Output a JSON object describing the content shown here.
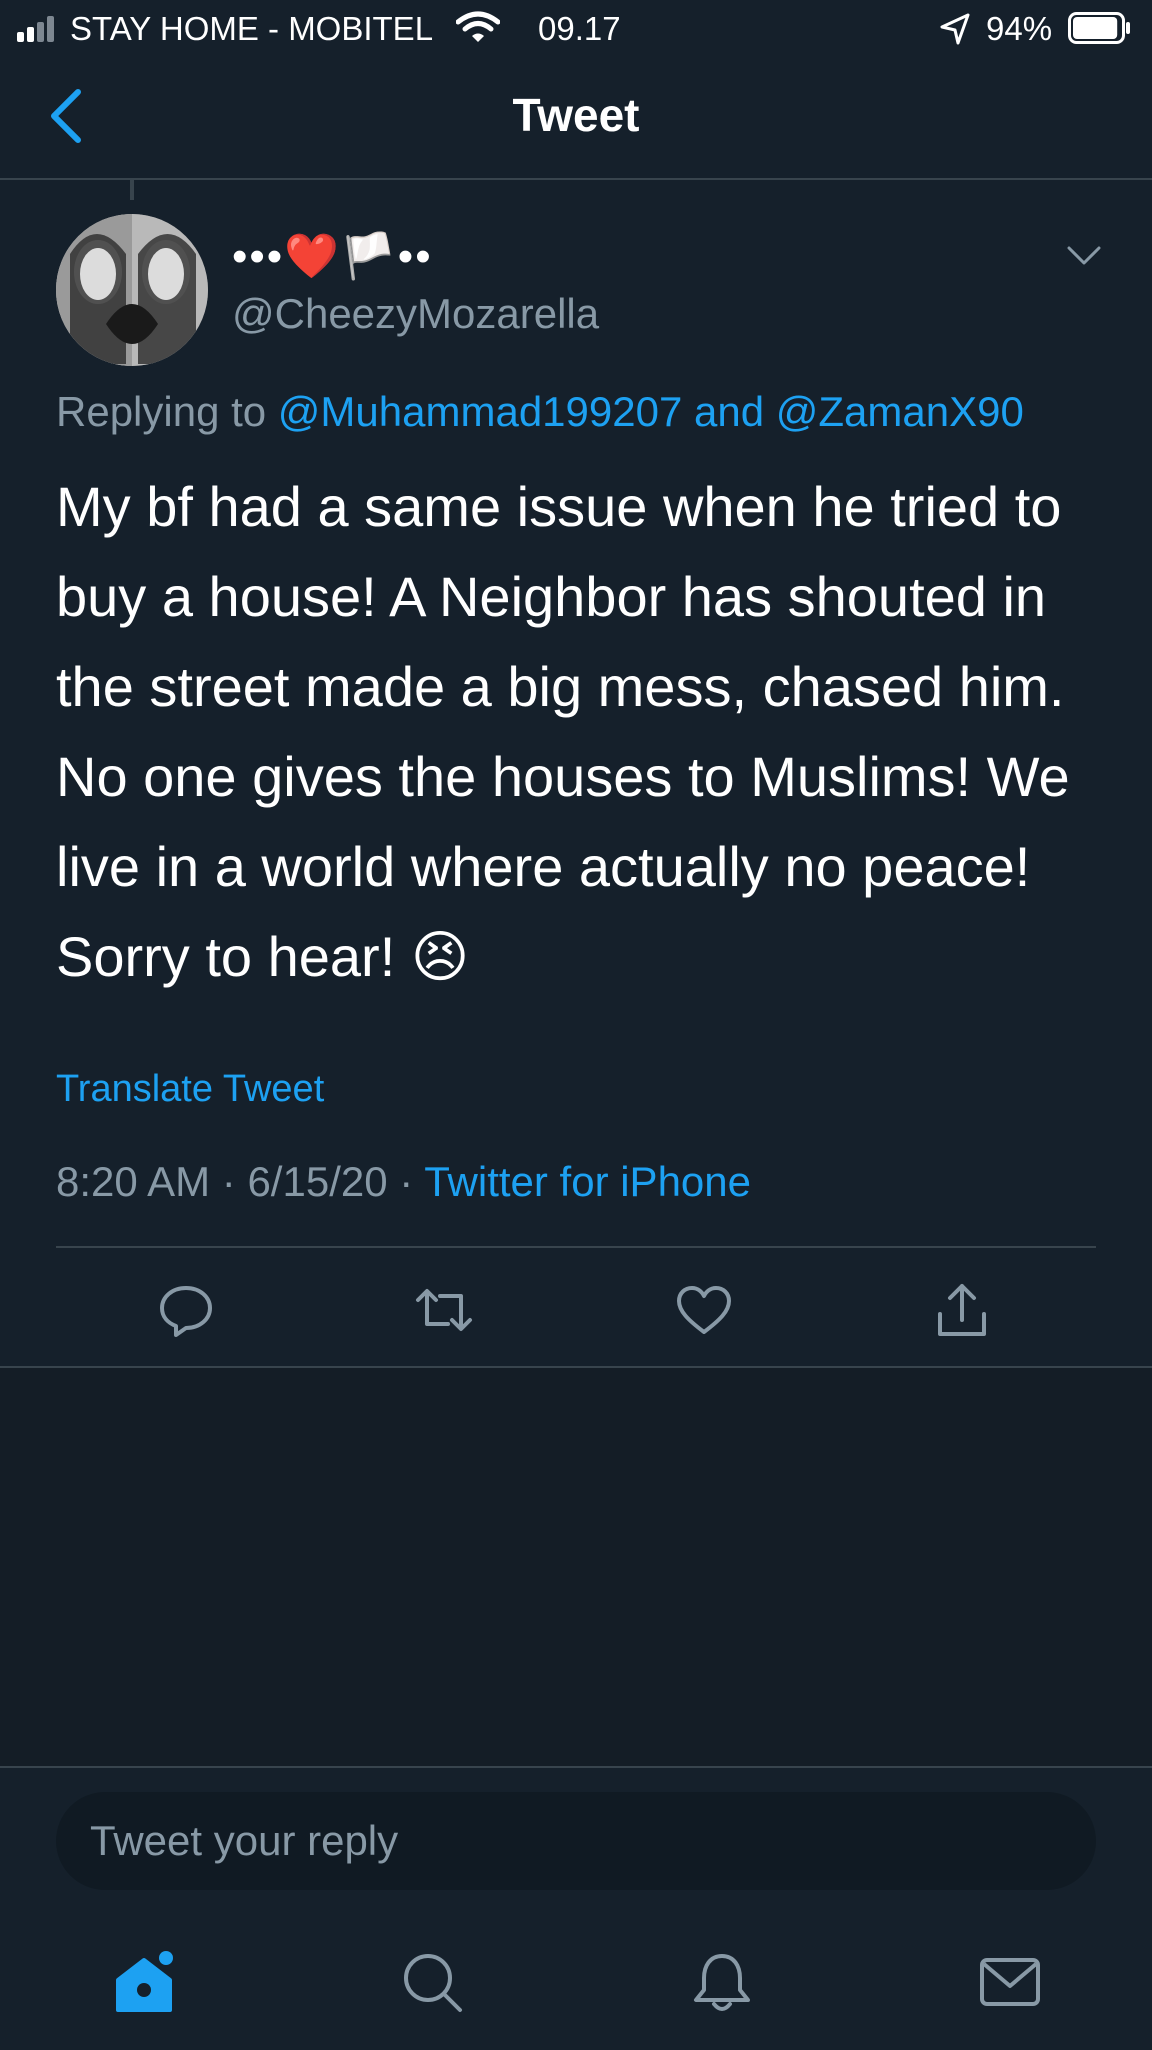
{
  "status_bar": {
    "carrier": "STAY HOME - MOBITEL",
    "time": "09.17",
    "battery_percent": "94%",
    "battery_level": 0.94
  },
  "header": {
    "title": "Tweet",
    "back_icon": "chevron-left-icon"
  },
  "tweet": {
    "display_name": "•••❤️🏳️••",
    "handle": "@CheezyMozarella",
    "replying_prefix": "Replying to",
    "replying_user1": "@Muhammad199207",
    "replying_and": "and",
    "replying_user2": "@ZamanX90",
    "text": "My bf had a same issue when he tried to buy a house! A Neighbor has shouted in the street made a big mess, chased him. No one gives the houses to Muslims! We live in a world where actually no peace! Sorry to hear! 😣",
    "translate_label": "Translate Tweet",
    "time": "8:20 AM",
    "separator": "·",
    "date": "6/15/20",
    "source": "Twitter for iPhone"
  },
  "actions": {
    "icons": [
      "reply-icon",
      "retweet-icon",
      "like-icon",
      "share-icon"
    ]
  },
  "reply": {
    "placeholder": "Tweet your reply"
  },
  "tab_bar": {
    "icons": [
      "home-icon",
      "search-icon",
      "notifications-icon",
      "messages-icon"
    ],
    "active": "home-icon"
  },
  "colors": {
    "background": "#15202b",
    "accent": "#1da1f2",
    "secondary_text": "#8899a6",
    "divider": "#38444d"
  }
}
